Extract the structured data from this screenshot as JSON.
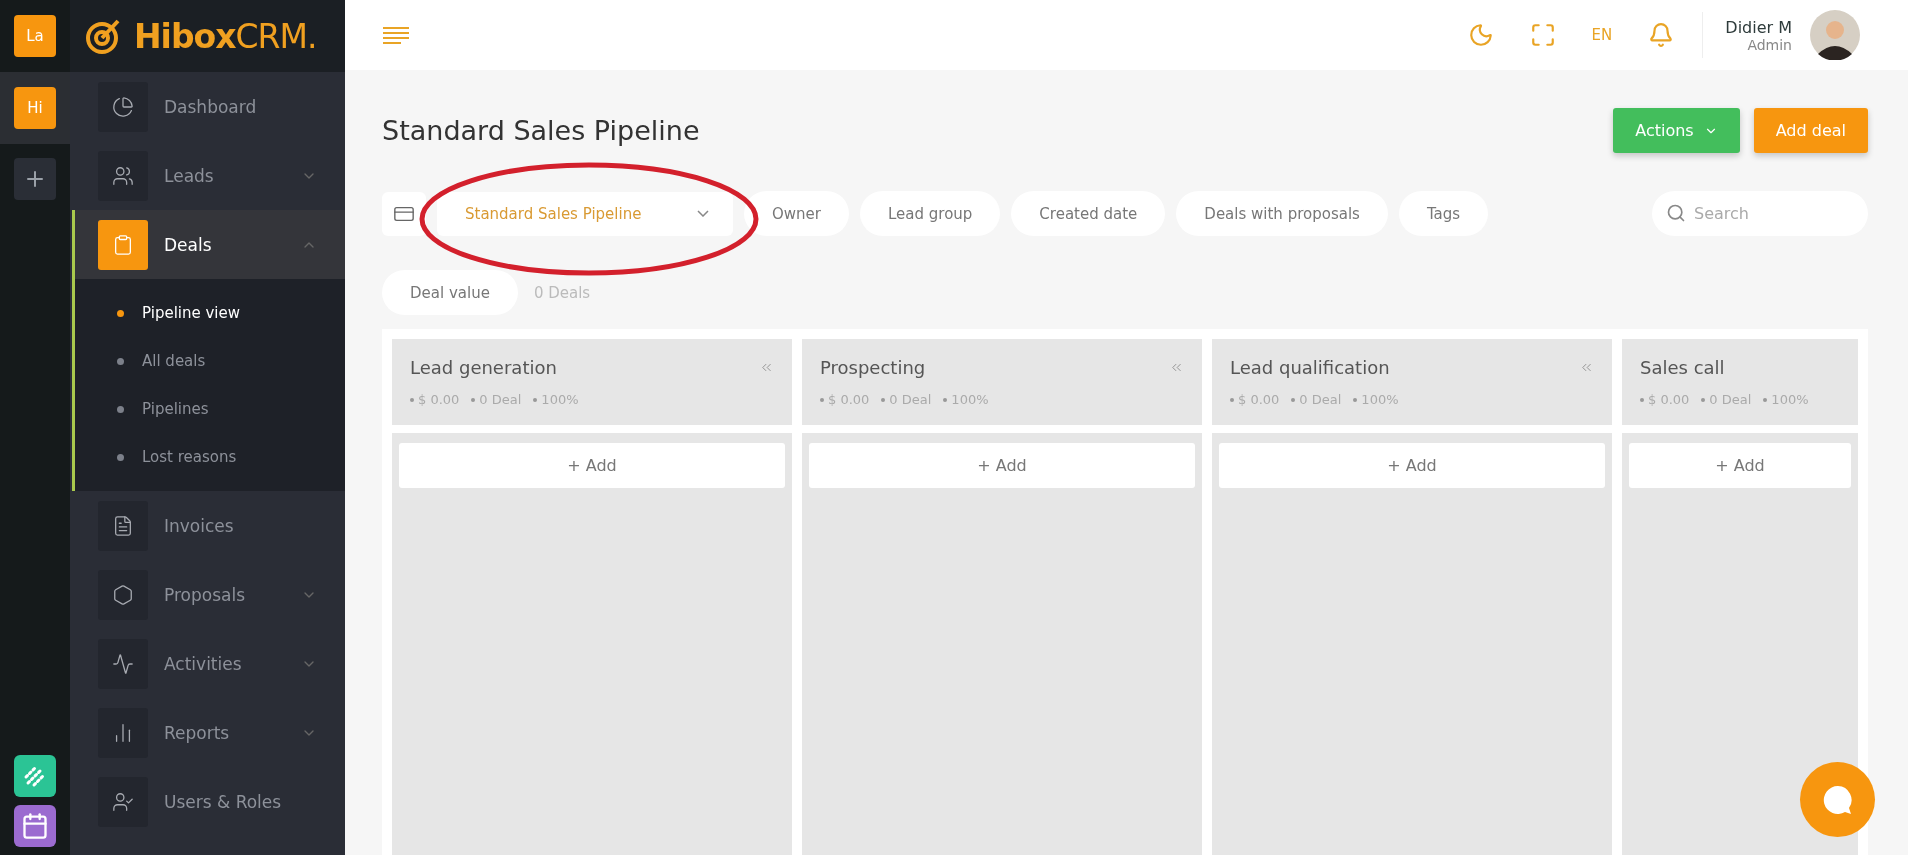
{
  "rail": {
    "items": [
      {
        "label": "La",
        "selected": false
      },
      {
        "label": "Hi",
        "selected": true
      }
    ]
  },
  "brand": {
    "name": "Hibox",
    "suffix": "CRM."
  },
  "sidebar": {
    "items": [
      {
        "label": "Dashboard",
        "selected": false
      },
      {
        "label": "Leads",
        "selected": false,
        "expanded": false
      },
      {
        "label": "Deals",
        "selected": true,
        "expanded": true,
        "children": [
          {
            "label": "Pipeline view",
            "selected": true
          },
          {
            "label": "All deals",
            "selected": false
          },
          {
            "label": "Pipelines",
            "selected": false
          },
          {
            "label": "Lost reasons",
            "selected": false
          }
        ]
      },
      {
        "label": "Invoices",
        "selected": false
      },
      {
        "label": "Proposals",
        "selected": false,
        "expanded": false
      },
      {
        "label": "Activities",
        "selected": false,
        "expanded": false
      },
      {
        "label": "Reports",
        "selected": false,
        "expanded": false
      },
      {
        "label": "Users & Roles",
        "selected": false
      }
    ]
  },
  "header": {
    "language": "EN",
    "user": {
      "name": "Didier M",
      "role": "Admin"
    }
  },
  "page": {
    "title": "Standard Sales Pipeline",
    "actions_button": "Actions",
    "add_button": "Add deal"
  },
  "filters": {
    "pipeline": "Standard Sales Pipeline",
    "chips": [
      "Owner",
      "Lead group",
      "Created date",
      "Deals with proposals",
      "Tags"
    ],
    "search": {
      "placeholder": "Search"
    },
    "sort_chip": "Deal value",
    "deal_count": "0 Deals"
  },
  "columns": [
    {
      "title": "Lead generation",
      "stats": [
        "$ 0.00",
        "0 Deal",
        "100%"
      ],
      "add_label": "+ Add"
    },
    {
      "title": "Prospecting",
      "stats": [
        "$ 0.00",
        "0 Deal",
        "100%"
      ],
      "add_label": "+ Add"
    },
    {
      "title": "Lead qualification",
      "stats": [
        "$ 0.00",
        "0 Deal",
        "100%"
      ],
      "add_label": "+ Add"
    },
    {
      "title": "Sales call",
      "stats": [
        "$ 0.00",
        "0 Deal",
        "100%"
      ],
      "add_label": "+ Add"
    }
  ]
}
